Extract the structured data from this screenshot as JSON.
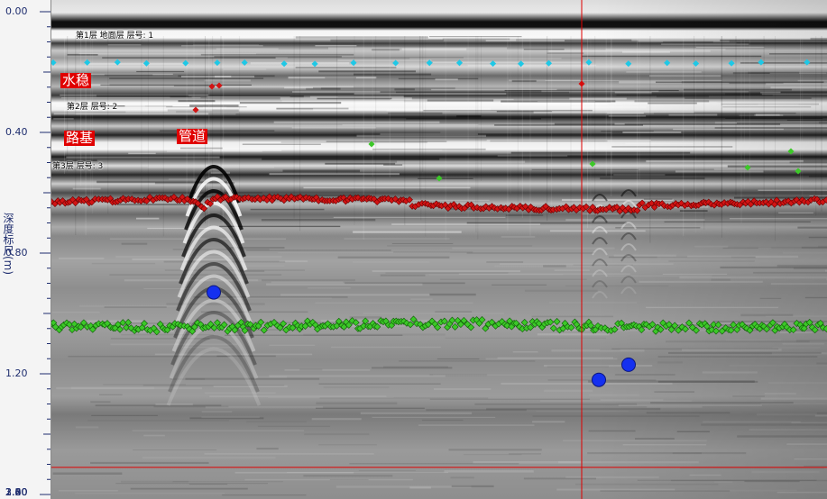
{
  "chart_data": {
    "type": "scatter",
    "ylabel": "深度标尺(m)",
    "ylim": [
      0.0,
      3.26
    ],
    "y_ticks": [
      "0.00",
      "0.40",
      "0.80",
      "1.20",
      "1.60",
      "2.00",
      "2.40",
      "2.80",
      "3.20"
    ],
    "cursor": {
      "depth": 1.51
    },
    "layers": [
      {
        "label": "第1层 地面层 层号: 1",
        "depth": 0.17,
        "color": "#1ec8e6"
      },
      {
        "label": "第2层 层号: 2",
        "depth": 0.63,
        "color": "#d21414"
      },
      {
        "label": "第3层 层号: 3",
        "depth": 1.04,
        "color": "#3cc828"
      }
    ],
    "tags": [
      "水稳",
      "路基",
      "管道"
    ],
    "pipes": [
      {
        "depth": 0.93
      },
      {
        "depth": 1.22
      },
      {
        "depth": 1.17
      }
    ],
    "colors": {
      "marker_pipe": "#1430f0",
      "tag_bg": "#e00000",
      "cursor": "#e00000"
    }
  }
}
